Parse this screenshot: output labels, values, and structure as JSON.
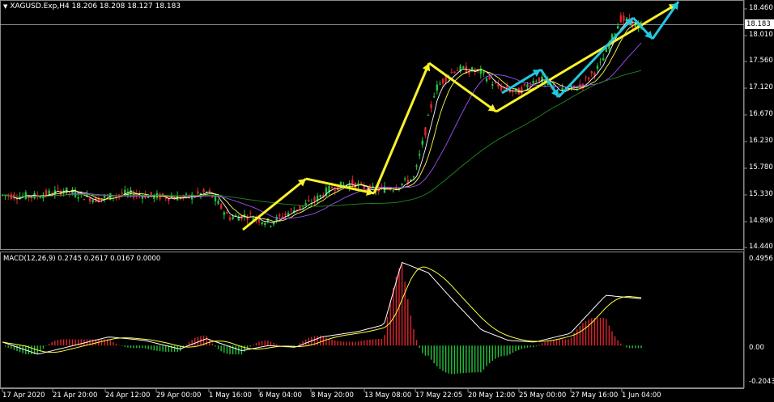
{
  "main": {
    "symbol_line": "XAGUSD.Exp,H4  18.206 18.208 18.127 18.183",
    "current_price": "18.183",
    "price_axis": [
      "18.460",
      "18.010",
      "17.560",
      "17.120",
      "16.670",
      "16.230",
      "15.780",
      "15.330",
      "14.890",
      "14.440"
    ]
  },
  "macd": {
    "label": "MACD(12,26,9) 0.2745 0.2617 0.0167 0.0000",
    "axis": [
      "0.4956",
      "0.00",
      "-0.2043"
    ]
  },
  "time_axis": [
    "17 Apr 2020",
    "21 Apr 20:00",
    "24 Apr 12:00",
    "29 Apr 00:00",
    "1 May 16:00",
    "6 May 04:00",
    "8 May 20:00",
    "13 May 08:00",
    "17 May 22:05",
    "20 May 12:00",
    "25 May 00:00",
    "27 May 16:00",
    "1 Jun 04:00"
  ],
  "colors": {
    "bull": "#22c43a",
    "bear": "#e0242c",
    "ma_fast": "#ffffff",
    "ma_mid": "#ffff55",
    "ma_slow": "#a050ff",
    "ma_long": "#1e8c1e",
    "arrow_yellow": "#f8f22a",
    "arrow_cyan": "#22c8e0",
    "macd_line": "#ffffff",
    "signal_line": "#ffff40"
  },
  "icons": {
    "dropdown": "triangle-down-icon"
  }
}
